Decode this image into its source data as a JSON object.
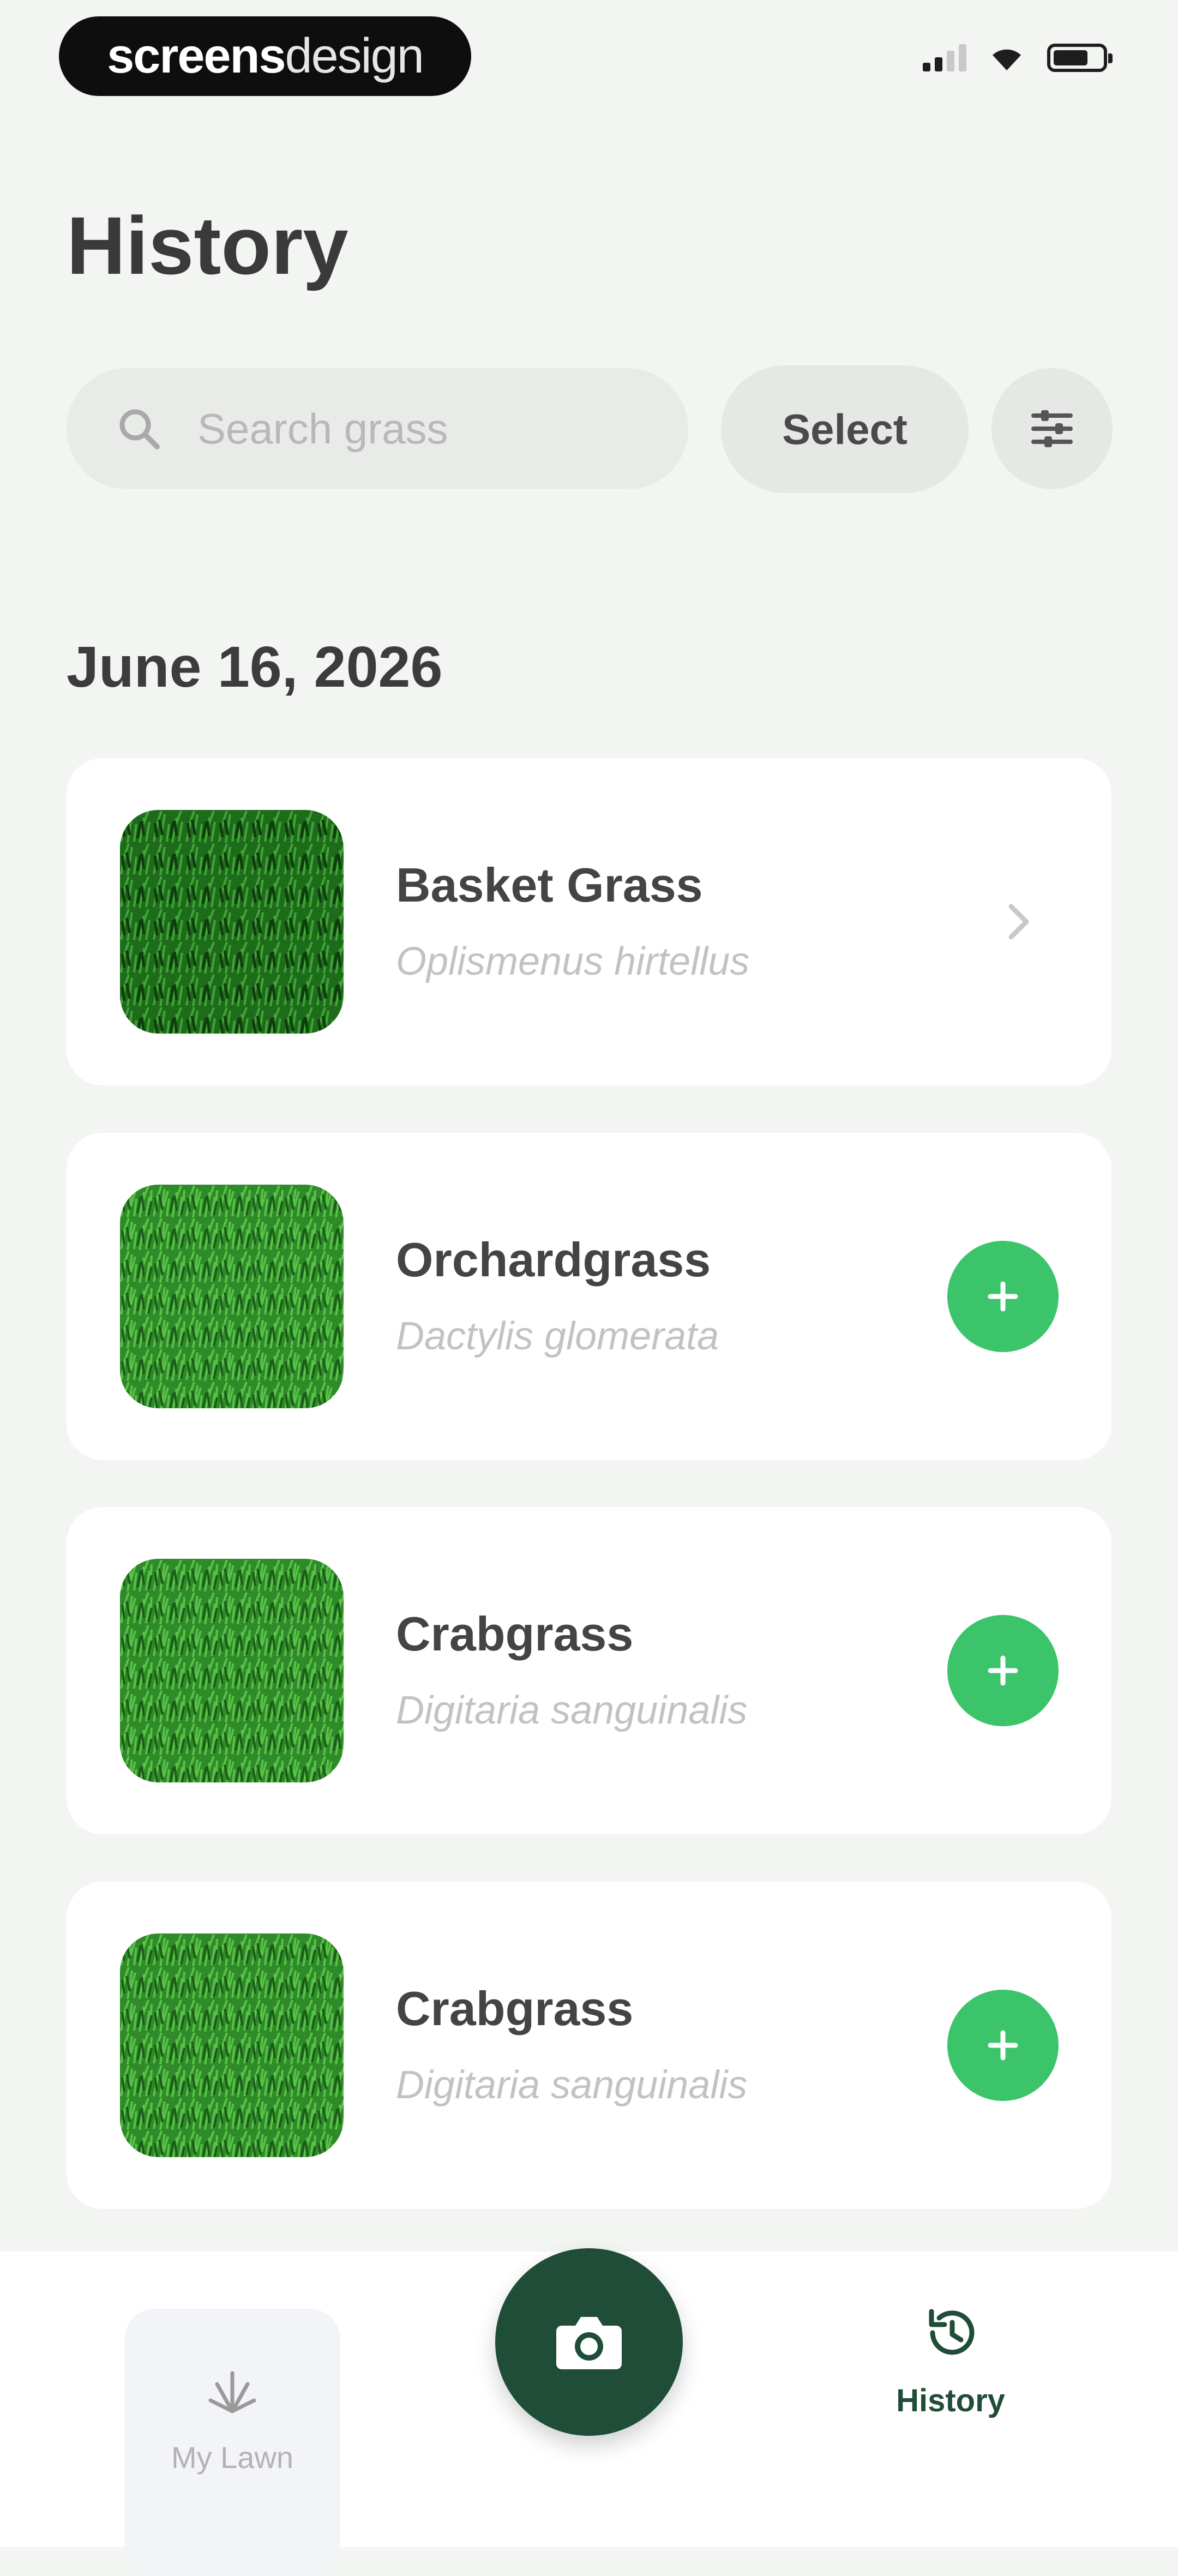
{
  "status_bar": {
    "brand_bold": "screens",
    "brand_light": "design"
  },
  "header": {
    "title": "History"
  },
  "search": {
    "placeholder": "Search grass",
    "icon": "search-icon"
  },
  "toolbar": {
    "select_label": "Select",
    "filter_icon": "filter-icon"
  },
  "sections": [
    {
      "date": "June 16, 2026",
      "items": [
        {
          "name": "Basket Grass",
          "scientific": "Oplismenus hirtellus",
          "action": "chevron-right-icon"
        },
        {
          "name": "Orchardgrass",
          "scientific": "Dactylis glomerata",
          "action": "add-button"
        },
        {
          "name": "Crabgrass",
          "scientific": "Digitaria sanguinalis",
          "action": "add-button"
        },
        {
          "name": "Crabgrass",
          "scientific": "Digitaria sanguinalis",
          "action": "add-button"
        }
      ]
    }
  ],
  "bottom_nav": {
    "lawn_label": "My Lawn",
    "history_label": "History",
    "camera_icon": "camera-icon"
  },
  "colors": {
    "background": "#f3f5f2",
    "accent_green": "#3cc46a",
    "dark_green": "#1f4d38",
    "card": "#ffffff"
  }
}
